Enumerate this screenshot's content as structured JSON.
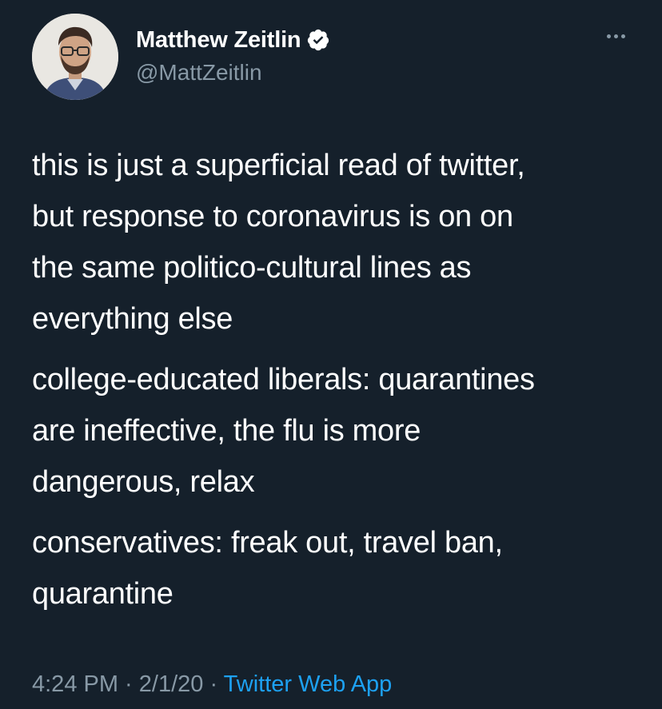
{
  "author": {
    "display_name": "Matthew Zeitlin",
    "handle": "@MattZeitlin",
    "verified": true
  },
  "tweet": {
    "paragraphs": [
      "this is just a superficial read of twitter,\nbut response to coronavirus is on on\nthe same politico-cultural lines as\neverything else",
      "college-educated liberals: quarantines\nare ineffective, the flu is more\ndangerous, relax",
      "conservatives: freak out, travel ban,\nquarantine"
    ]
  },
  "meta": {
    "time": "4:24 PM",
    "separator": " · ",
    "date": "2/1/20",
    "source": "Twitter Web App"
  },
  "icons": {
    "verified": "verified-badge-icon",
    "more": "more-horizontal-icon"
  },
  "colors": {
    "background": "#15202b",
    "text": "#ffffff",
    "secondary": "#8899a6",
    "accent": "#1da1f2"
  }
}
